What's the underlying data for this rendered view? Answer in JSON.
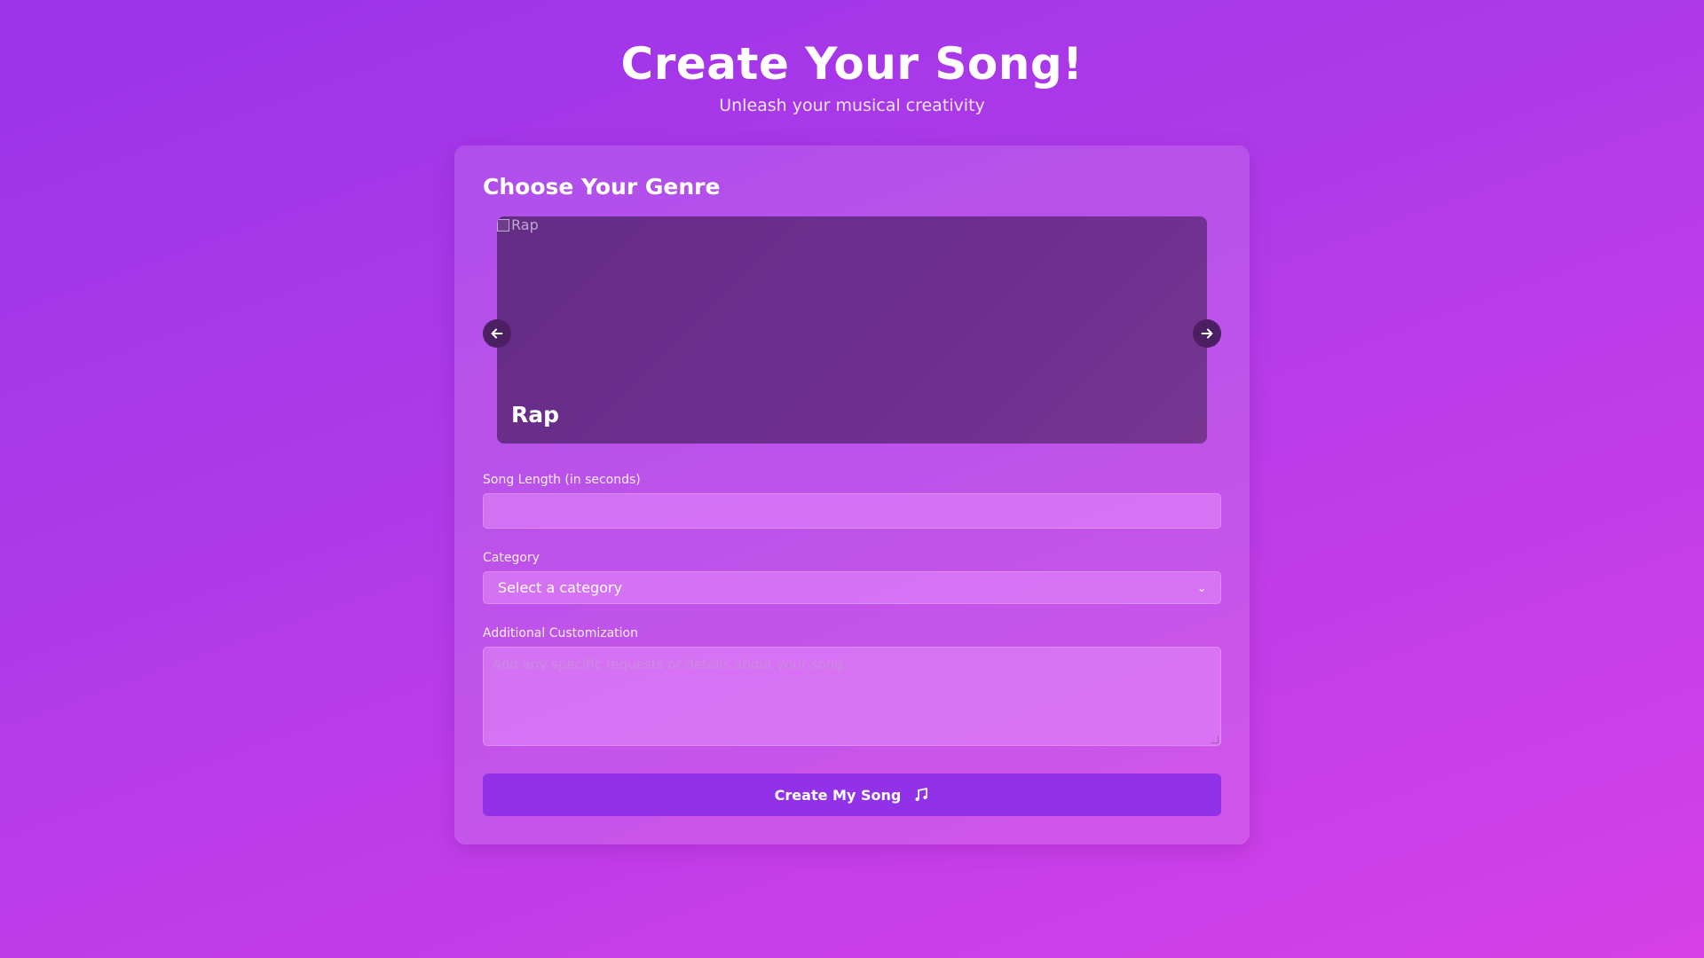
{
  "header": {
    "title": "Create Your Song!",
    "subtitle": "Unleash your musical creativity"
  },
  "genre_section": {
    "title": "Choose Your Genre",
    "current_genre": "Rap",
    "image_alt": "Rap",
    "prev_icon": "arrow-left-icon",
    "next_icon": "arrow-right-icon"
  },
  "form": {
    "song_length": {
      "label": "Song Length (in seconds)",
      "value": "",
      "placeholder": ""
    },
    "category": {
      "label": "Category",
      "selected": "Select a category",
      "icon": "chevron-down-icon"
    },
    "customization": {
      "label": "Additional Customization",
      "placeholder": "Add any specific requests or details about your song..."
    },
    "submit": {
      "label": "Create My Song",
      "icon": "music-note-icon"
    }
  },
  "colors": {
    "background_start": "#9a33ea",
    "background_end": "#d640e8",
    "carousel": "#6e2e90",
    "button": "#9232e8",
    "nav_button": "#4c1f63"
  }
}
